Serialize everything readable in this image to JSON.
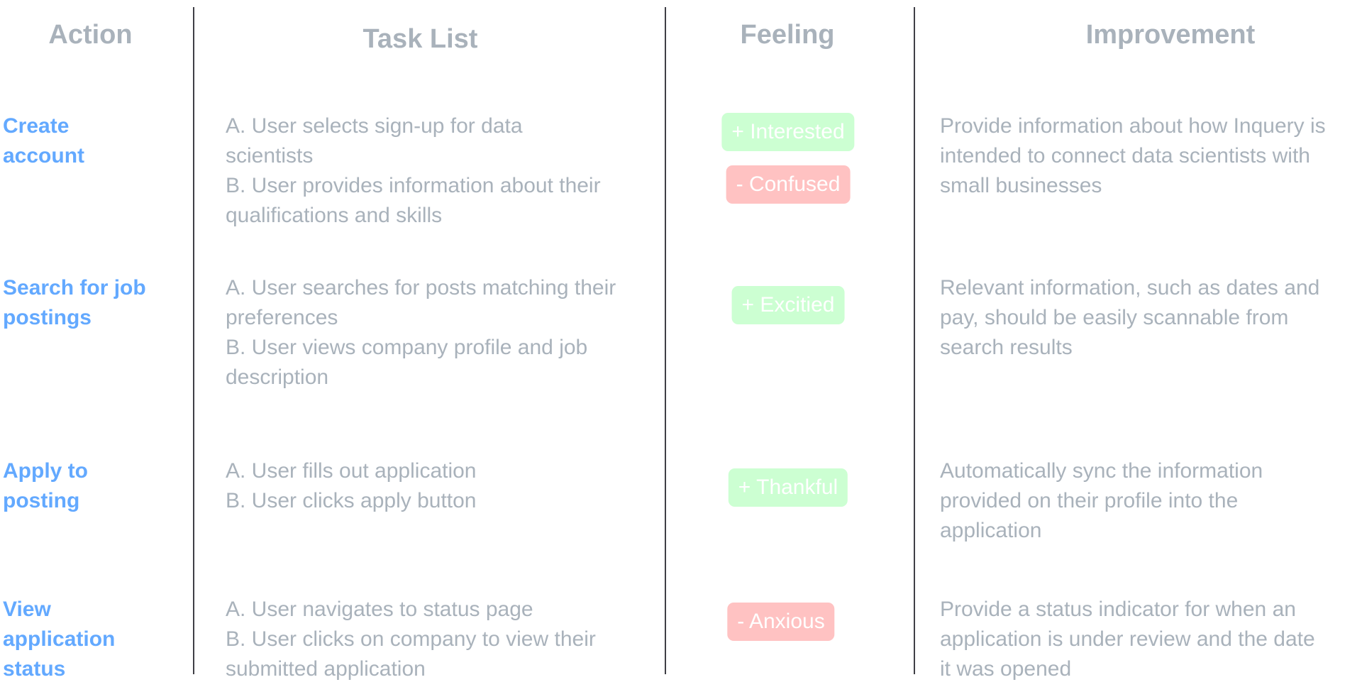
{
  "headers": {
    "action": "Action",
    "task_list": "Task List",
    "feeling": "Feeling",
    "improvement": "Improvement"
  },
  "colors": {
    "action_text": "#63a9ff",
    "muted_text": "#a9b2bb",
    "positive_badge": "#ccffd2",
    "negative_badge": "#ffc2c2",
    "divider": "#3f3f46"
  },
  "rows": [
    {
      "action": "Create account",
      "tasks": [
        "A. User selects sign-up for data scientists",
        "B. User provides information about their qualifications and skills"
      ],
      "feelings": [
        {
          "label": "+ Interested",
          "sentiment": "positive"
        },
        {
          "label": "- Confused",
          "sentiment": "negative"
        }
      ],
      "improvement": "Provide information about how Inquery is intended to connect data scientists with small businesses"
    },
    {
      "action": "Search for job postings",
      "tasks": [
        "A. User searches for posts matching their preferences",
        "B. User views company profile and job description"
      ],
      "feelings": [
        {
          "label": "+ Excitied",
          "sentiment": "positive"
        }
      ],
      "improvement": "Relevant information, such as dates and pay, should be easily scannable from search results"
    },
    {
      "action": "Apply to posting",
      "tasks": [
        "A. User fills out application",
        "B. User clicks apply button"
      ],
      "feelings": [
        {
          "label": "+ Thankful",
          "sentiment": "positive"
        }
      ],
      "improvement": "Automatically sync the information provided on their profile into the application"
    },
    {
      "action": "View application status",
      "tasks": [
        "A. User navigates to status page",
        "B. User clicks on company to view their submitted application"
      ],
      "feelings": [
        {
          "label": "- Anxious",
          "sentiment": "negative"
        }
      ],
      "improvement": "Provide a status indicator for when an application is under review and the date it was opened"
    }
  ]
}
